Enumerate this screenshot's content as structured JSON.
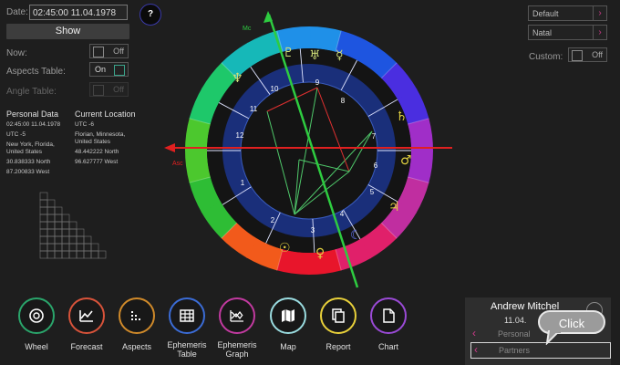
{
  "date": {
    "label": "Date:",
    "value": "02:45:00 11.04.1978"
  },
  "help": {
    "label": "?"
  },
  "show_button": "Show",
  "settings": [
    {
      "label": "Now:",
      "state": "Off"
    },
    {
      "label": "Aspects Table:",
      "state": "On"
    },
    {
      "label": "Angle Table:",
      "state": "Off"
    }
  ],
  "personal": {
    "title": "Personal Data",
    "lines": [
      "02:45:00 11.04.1978",
      "UTC -5",
      "New York, Florida,",
      "United States",
      "30.838333 North",
      "87.200833 West"
    ]
  },
  "current": {
    "title": "Current Location",
    "lines": [
      "UTC -6",
      "Florian, Minnesota,",
      "United States",
      "48.442222 North",
      "96.627777 West"
    ]
  },
  "right_selects": [
    {
      "value": "Default"
    },
    {
      "value": "Natal"
    }
  ],
  "custom": {
    "label": "Custom:",
    "state": "Off"
  },
  "wheel": {
    "mc_label": "Mc",
    "asc_label": "Asc",
    "houses": [
      "1",
      "2",
      "3",
      "4",
      "5",
      "6",
      "7",
      "8",
      "9",
      "10",
      "11",
      "12"
    ]
  },
  "toolbar": [
    {
      "label": "Wheel",
      "color": "#2aa56b"
    },
    {
      "label": "Forecast",
      "color": "#d8533a"
    },
    {
      "label": "Aspects",
      "color": "#d08a2a"
    },
    {
      "label": "Ephemeris Table",
      "color": "#3b6cd6"
    },
    {
      "label": "Ephemeris Graph",
      "color": "#c23aa0"
    },
    {
      "label": "Map",
      "color": "#9adce0"
    },
    {
      "label": "Report",
      "color": "#e8d03a"
    },
    {
      "label": "Chart",
      "color": "#9a4ad6"
    }
  ],
  "profile": {
    "name": "Andrew Mitchel",
    "date_partial": "11.04.",
    "row1": "Personal",
    "row2": "Partners"
  },
  "callout": "Click",
  "colors": {
    "accent": "#d13a8c",
    "mc_line": "#2ecc40",
    "asc_line": "#e02020"
  }
}
